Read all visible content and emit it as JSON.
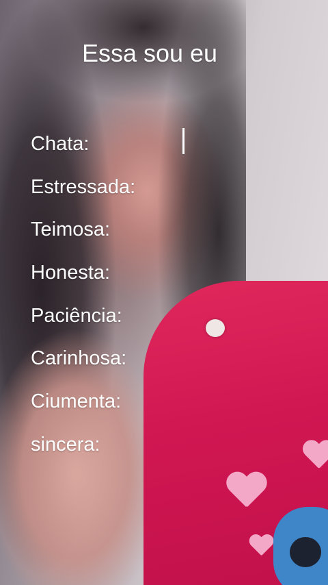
{
  "story": {
    "title": "Essa sou eu",
    "fields": [
      "Chata:",
      "Estressada:",
      "Teimosa:",
      "Honesta:",
      "Paciência:",
      "Carinhosa:",
      "Ciumenta:",
      "sincera:"
    ]
  },
  "colors": {
    "text": "#ffffff",
    "shirt": "#d11752",
    "hearts": "#f4a8c7"
  }
}
